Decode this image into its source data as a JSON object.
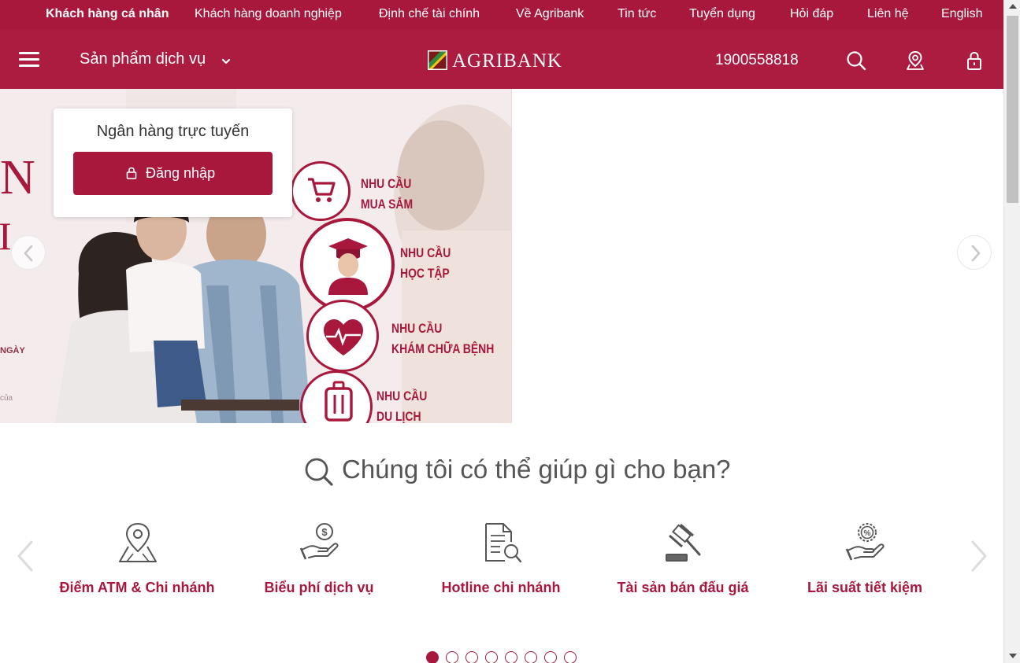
{
  "topnav": {
    "items": [
      {
        "label": "Khách hàng cá nhân",
        "active": true
      },
      {
        "label": "Khách hàng doanh nghiệp"
      },
      {
        "label": "Định chế tài chính"
      },
      {
        "label": "Về Agribank"
      },
      {
        "label": "Tin tức"
      },
      {
        "label": "Tuyển dụng"
      },
      {
        "label": "Hỏi đáp"
      },
      {
        "label": "Liên hệ"
      },
      {
        "label": "English"
      }
    ]
  },
  "header": {
    "menu_icon": "hamburger-icon",
    "products_label": "Sản phẩm dịch vụ",
    "logo_text": "AGRIBANK",
    "hotline": "1900558818",
    "icons": [
      "search-icon",
      "location-icon",
      "lock-icon"
    ]
  },
  "hero": {
    "login_card": {
      "title": "Ngân hàng trực tuyến",
      "button_label": "Đăng nhập"
    },
    "banner_texts": [
      "NHU CẦU\nMUA SẮM",
      "NHU CẦU\nHỌC TẬP",
      "NHU CẦU\nKHÁM CHỮA BỆNH",
      "NHU CẦU\nDU LỊCH"
    ],
    "banner_fragments": [
      "N",
      "I",
      "NGÀY",
      "của"
    ]
  },
  "help": {
    "title": "Chúng tôi có thể giúp gì cho bạn?",
    "services": [
      {
        "label": "Điểm ATM & Chi nhánh",
        "icon": "map-pin-icon"
      },
      {
        "label": "Biểu phí dịch vụ",
        "icon": "fee-hand-icon"
      },
      {
        "label": "Hotline chi nhánh",
        "icon": "document-search-icon"
      },
      {
        "label": "Tài sản bán đấu giá",
        "icon": "auction-gavel-icon"
      },
      {
        "label": "Lãi suất tiết kiệm",
        "icon": "interest-hand-icon"
      }
    ],
    "pagination": {
      "total": 8,
      "current": 1
    }
  },
  "colors": {
    "brand": "#a8183c",
    "header": "#ab1c40",
    "text": "#555555"
  }
}
